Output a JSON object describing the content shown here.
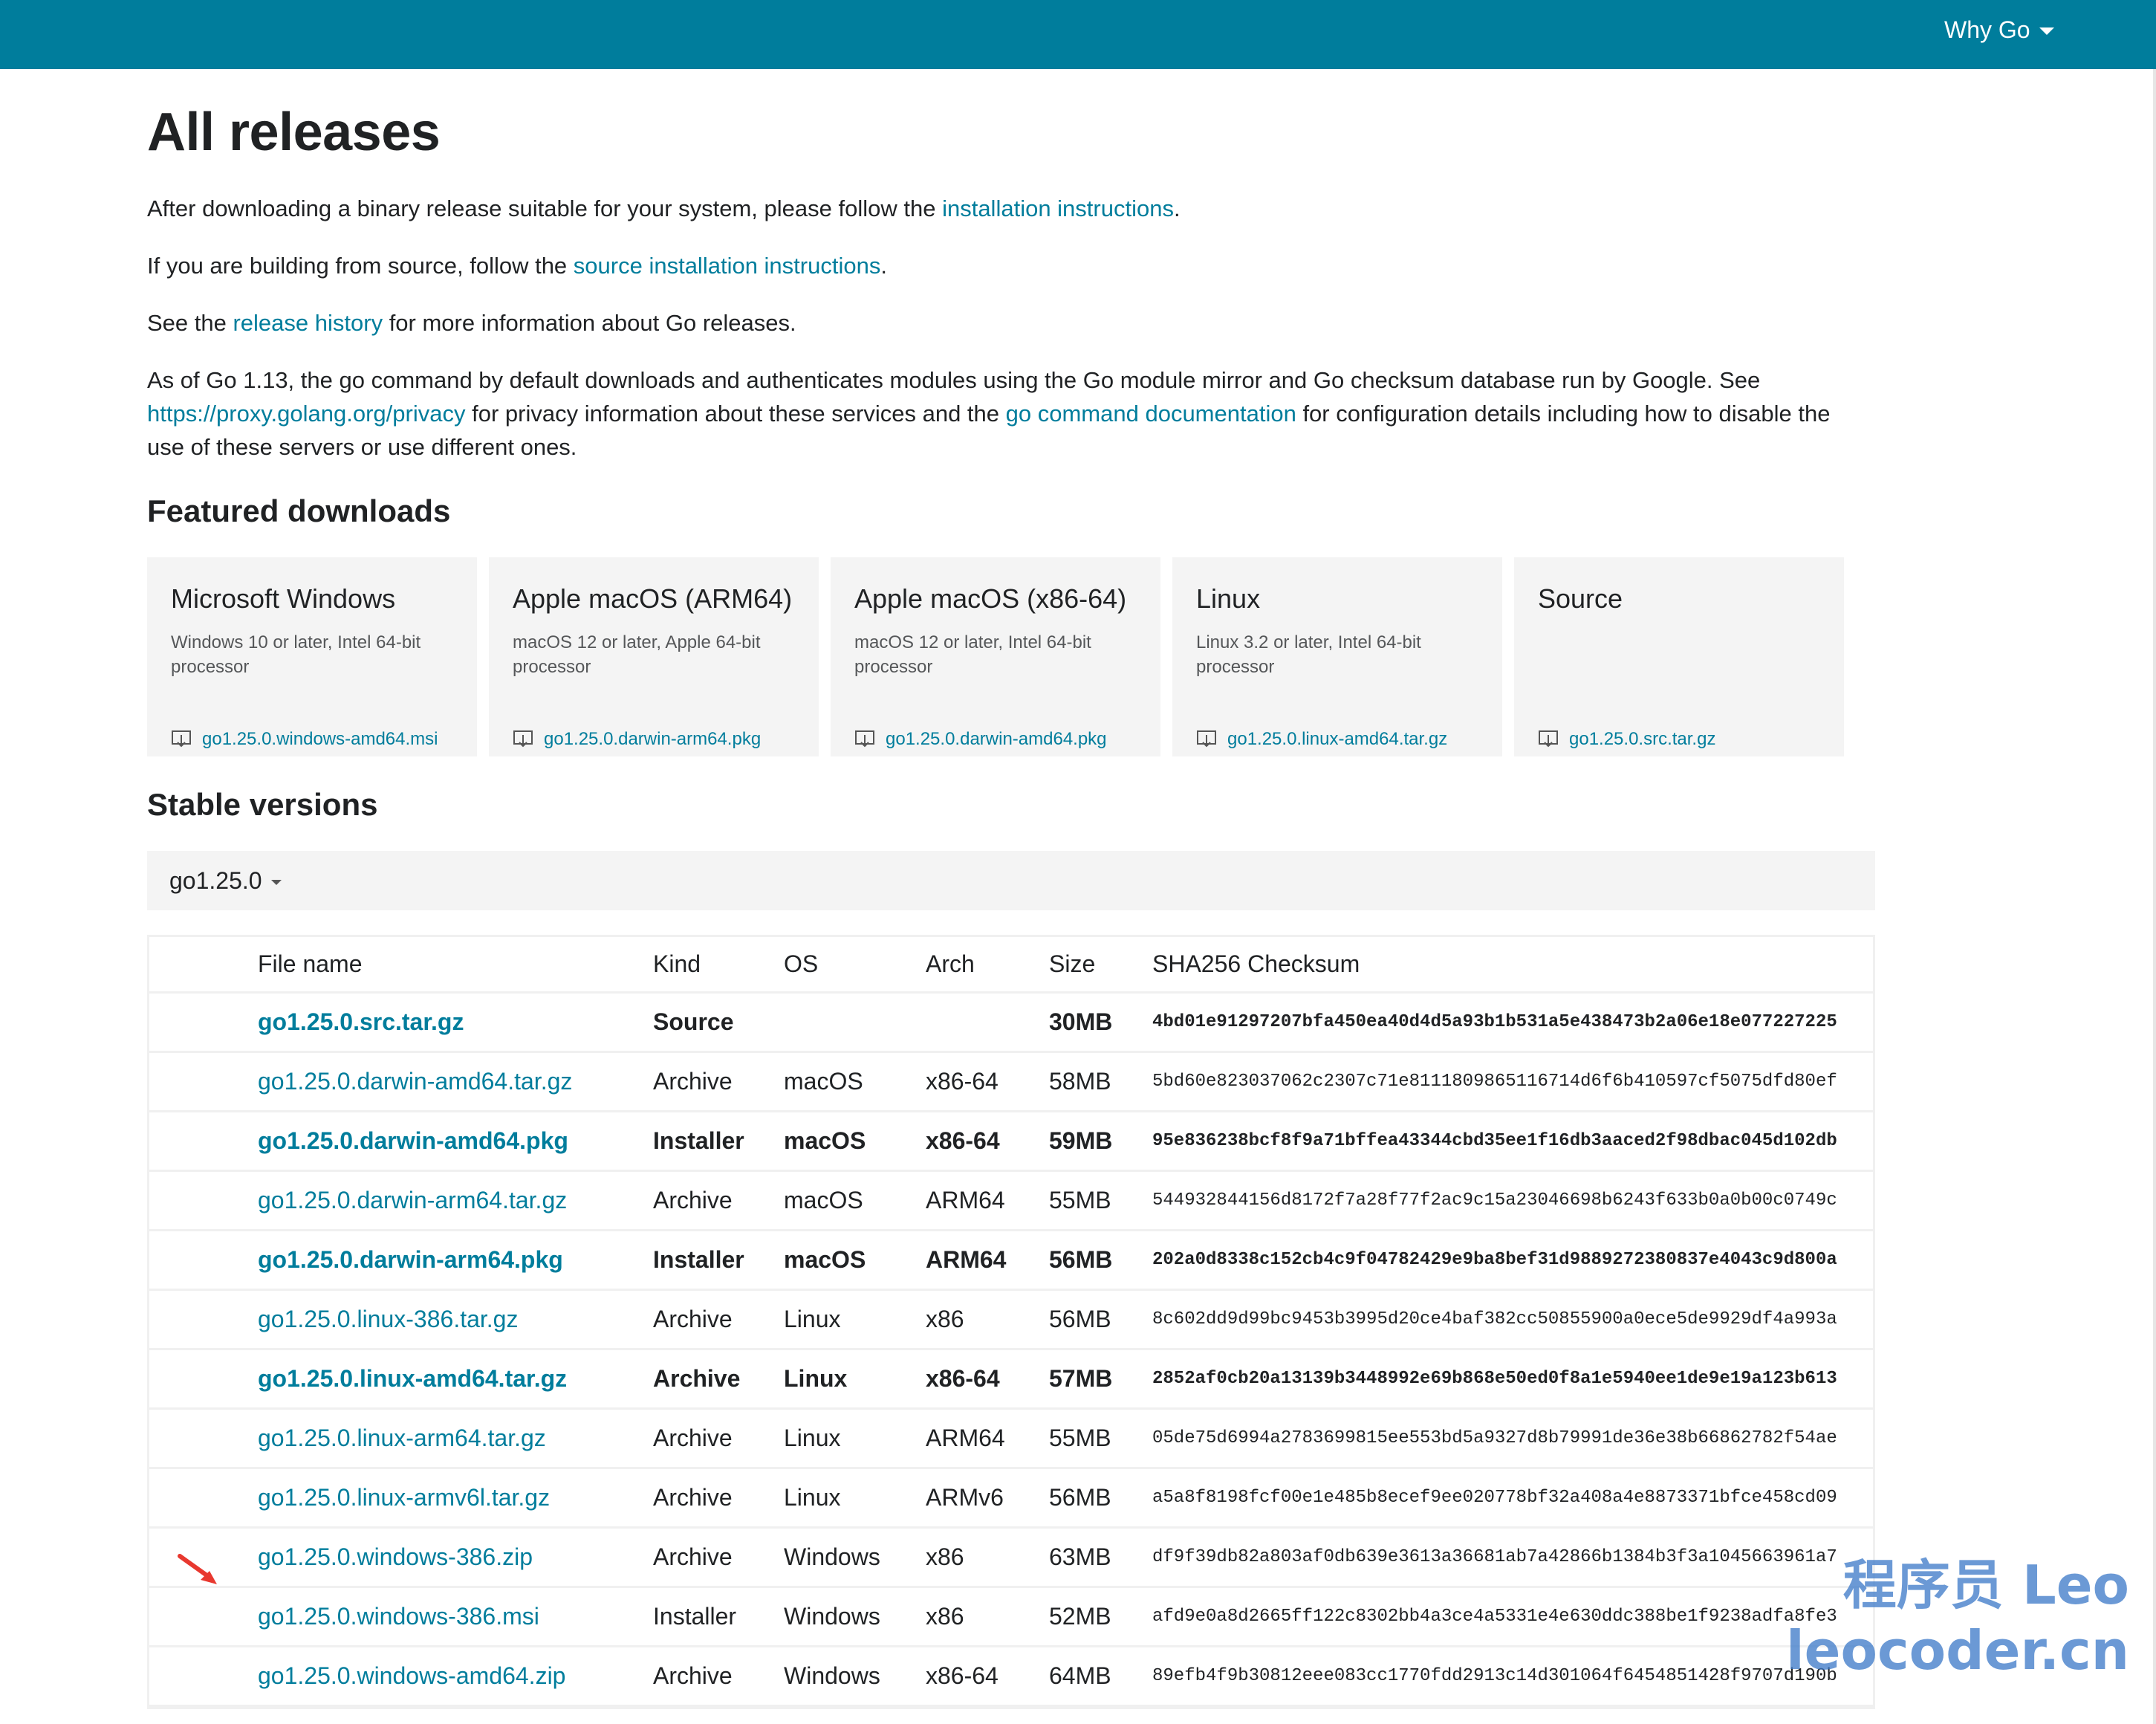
{
  "topbar": {
    "why_go": "Why Go"
  },
  "page_title": "All releases",
  "intro": {
    "p1_before": "After downloading a binary release suitable for your system, please follow the ",
    "p1_link": "installation instructions",
    "p1_after": ".",
    "p2_before": "If you are building from source, follow the ",
    "p2_link": "source installation instructions",
    "p2_after": ".",
    "p3_before": "See the ",
    "p3_link": "release history",
    "p3_after": " for more information about Go releases.",
    "p4_text1": "As of Go 1.13, the go command by default downloads and authenticates modules using the Go module mirror and Go checksum database run by Google. See ",
    "p4_link1": "https://proxy.golang.org/privacy",
    "p4_text2": " for privacy information about these services and the ",
    "p4_link2": "go command documentation",
    "p4_text3": " for configuration details including how to disable the use of these servers or use different ones."
  },
  "featured": {
    "heading": "Featured downloads",
    "cards": [
      {
        "title": "Microsoft Windows",
        "desc": "Windows 10 or later, Intel 64-bit processor",
        "file": "go1.25.0.windows-amd64.msi"
      },
      {
        "title": "Apple macOS (ARM64)",
        "desc": "macOS 12 or later, Apple 64-bit processor",
        "file": "go1.25.0.darwin-arm64.pkg"
      },
      {
        "title": "Apple macOS (x86-64)",
        "desc": "macOS 12 or later, Intel 64-bit processor",
        "file": "go1.25.0.darwin-amd64.pkg"
      },
      {
        "title": "Linux",
        "desc": "Linux 3.2 or later, Intel 64-bit processor",
        "file": "go1.25.0.linux-amd64.tar.gz"
      },
      {
        "title": "Source",
        "desc": "",
        "file": "go1.25.0.src.tar.gz"
      }
    ]
  },
  "stable": {
    "heading": "Stable versions",
    "version": "go1.25.0",
    "columns": [
      "File name",
      "Kind",
      "OS",
      "Arch",
      "Size",
      "SHA256 Checksum"
    ],
    "rows": [
      {
        "file": "go1.25.0.src.tar.gz",
        "kind": "Source",
        "os": "",
        "arch": "",
        "size": "30MB",
        "sha": "4bd01e91297207bfa450ea40d4d5a93b1b531a5e438473b2a06e18e077227225",
        "bold": true
      },
      {
        "file": "go1.25.0.darwin-amd64.tar.gz",
        "kind": "Archive",
        "os": "macOS",
        "arch": "x86-64",
        "size": "58MB",
        "sha": "5bd60e823037062c2307c71e8111809865116714d6f6b410597cf5075dfd80ef",
        "bold": false
      },
      {
        "file": "go1.25.0.darwin-amd64.pkg",
        "kind": "Installer",
        "os": "macOS",
        "arch": "x86-64",
        "size": "59MB",
        "sha": "95e836238bcf8f9a71bffea43344cbd35ee1f16db3aaced2f98dbac045d102db",
        "bold": true
      },
      {
        "file": "go1.25.0.darwin-arm64.tar.gz",
        "kind": "Archive",
        "os": "macOS",
        "arch": "ARM64",
        "size": "55MB",
        "sha": "544932844156d8172f7a28f77f2ac9c15a23046698b6243f633b0a0b00c0749c",
        "bold": false
      },
      {
        "file": "go1.25.0.darwin-arm64.pkg",
        "kind": "Installer",
        "os": "macOS",
        "arch": "ARM64",
        "size": "56MB",
        "sha": "202a0d8338c152cb4c9f04782429e9ba8bef31d9889272380837e4043c9d800a",
        "bold": true
      },
      {
        "file": "go1.25.0.linux-386.tar.gz",
        "kind": "Archive",
        "os": "Linux",
        "arch": "x86",
        "size": "56MB",
        "sha": "8c602dd9d99bc9453b3995d20ce4baf382cc50855900a0ece5de9929df4a993a",
        "bold": false
      },
      {
        "file": "go1.25.0.linux-amd64.tar.gz",
        "kind": "Archive",
        "os": "Linux",
        "arch": "x86-64",
        "size": "57MB",
        "sha": "2852af0cb20a13139b3448992e69b868e50ed0f8a1e5940ee1de9e19a123b613",
        "bold": true
      },
      {
        "file": "go1.25.0.linux-arm64.tar.gz",
        "kind": "Archive",
        "os": "Linux",
        "arch": "ARM64",
        "size": "55MB",
        "sha": "05de75d6994a2783699815ee553bd5a9327d8b79991de36e38b66862782f54ae",
        "bold": false
      },
      {
        "file": "go1.25.0.linux-armv6l.tar.gz",
        "kind": "Archive",
        "os": "Linux",
        "arch": "ARMv6",
        "size": "56MB",
        "sha": "a5a8f8198fcf00e1e485b8ecef9ee020778bf32a408a4e8873371bfce458cd09",
        "bold": false
      },
      {
        "file": "go1.25.0.windows-386.zip",
        "kind": "Archive",
        "os": "Windows",
        "arch": "x86",
        "size": "63MB",
        "sha": "df9f39db82a803af0db639e3613a36681ab7a42866b1384b3f3a1045663961a7",
        "bold": false
      },
      {
        "file": "go1.25.0.windows-386.msi",
        "kind": "Installer",
        "os": "Windows",
        "arch": "x86",
        "size": "52MB",
        "sha": "afd9e0a8d2665ff122c8302bb4a3ce4a5331e4e630ddc388be1f9238adfa8fe3",
        "bold": false
      },
      {
        "file": "go1.25.0.windows-amd64.zip",
        "kind": "Archive",
        "os": "Windows",
        "arch": "x86-64",
        "size": "64MB",
        "sha": "89efb4f9b30812eee083cc1770fdd2913c14d301064f6454851428f9707d190b",
        "bold": false
      }
    ]
  },
  "watermark": {
    "line1": "程序员 Leo",
    "line2": "leocoder.cn"
  },
  "colors": {
    "topbar": "#007d9c",
    "link": "#007d9c",
    "annotation_arrow": "#e8382f"
  }
}
